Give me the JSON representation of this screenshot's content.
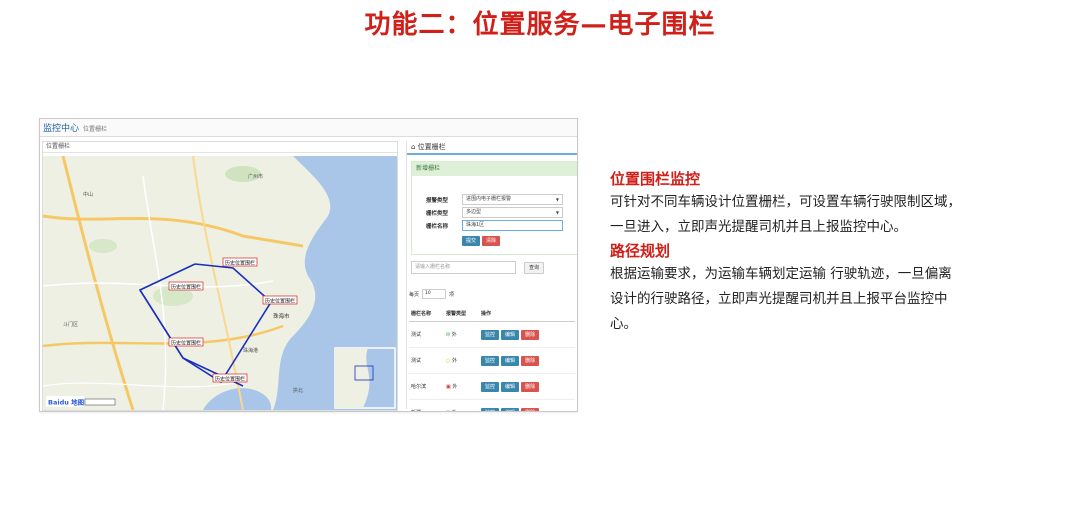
{
  "slide": {
    "title": "功能二：位置服务—电子围栏"
  },
  "screenshot": {
    "title": "监控中心",
    "subtitle": "位置栅栏",
    "map_panel_label": "位置栅栏",
    "map": {
      "fence_labels": [
        "历史位置围栏",
        "历史位置围栏",
        "历史位置围栏",
        "历史位置围栏",
        "历史位置围栏"
      ],
      "place_labels": [
        "珠海市",
        "珠海港",
        "广州市",
        "中山",
        "拱北",
        "斗门区"
      ],
      "logo": "Baidu 地图",
      "colors": {
        "land": "#eef0e4",
        "sea": "#a9c6e8",
        "road_major": "#f6c865",
        "fence": "#1a2fbf"
      }
    },
    "side": {
      "header": "位置栅栏",
      "add_box_title": "新增栅栏",
      "form": {
        "alarm_type_label": "报警类型",
        "alarm_type_value": "进围内电子栅栏报警",
        "fence_type_label": "栅栏类型",
        "fence_type_value": "多边型",
        "fence_name_label": "栅栏名称",
        "fence_name_value": "珠海1区",
        "submit": "提交",
        "clear": "清除"
      },
      "search": {
        "placeholder": "请输入栅栏名称",
        "button": "查询"
      },
      "perpage": {
        "prefix": "每页",
        "value": "10",
        "suffix": "项"
      },
      "table": {
        "headers": [
          "栅栏名称",
          "报警类型",
          "操作"
        ],
        "rows": [
          {
            "name": "测试",
            "alarm": "外",
            "icon": "green",
            "actions": [
              "监控",
              "编辑",
              "删除"
            ]
          },
          {
            "name": "测试",
            "alarm": "外",
            "icon": "yellow",
            "actions": [
              "监控",
              "编辑",
              "删除"
            ]
          },
          {
            "name": "哈尔滨",
            "alarm": "外",
            "icon": "red",
            "actions": [
              "监控",
              "编辑",
              "删除"
            ]
          },
          {
            "name": "新疆",
            "alarm": "外",
            "icon": "green",
            "actions": [
              "监控",
              "编辑",
              "删除"
            ]
          }
        ]
      }
    }
  },
  "sections": [
    {
      "title": "位置围栏监控",
      "lines": [
        "可针对不同车辆设计位置栅栏，可设置车辆行驶限制区域，",
        "一旦进入，立即声光提醒司机并且上报监控中心。"
      ]
    },
    {
      "title": "路径规划",
      "lines": [
        "根据运输要求，为运输车辆划定运输 行驶轨迹，一旦偏离",
        "设计的行驶路径，立即声光提醒司机并且上报平台监控中",
        "心。"
      ]
    }
  ]
}
